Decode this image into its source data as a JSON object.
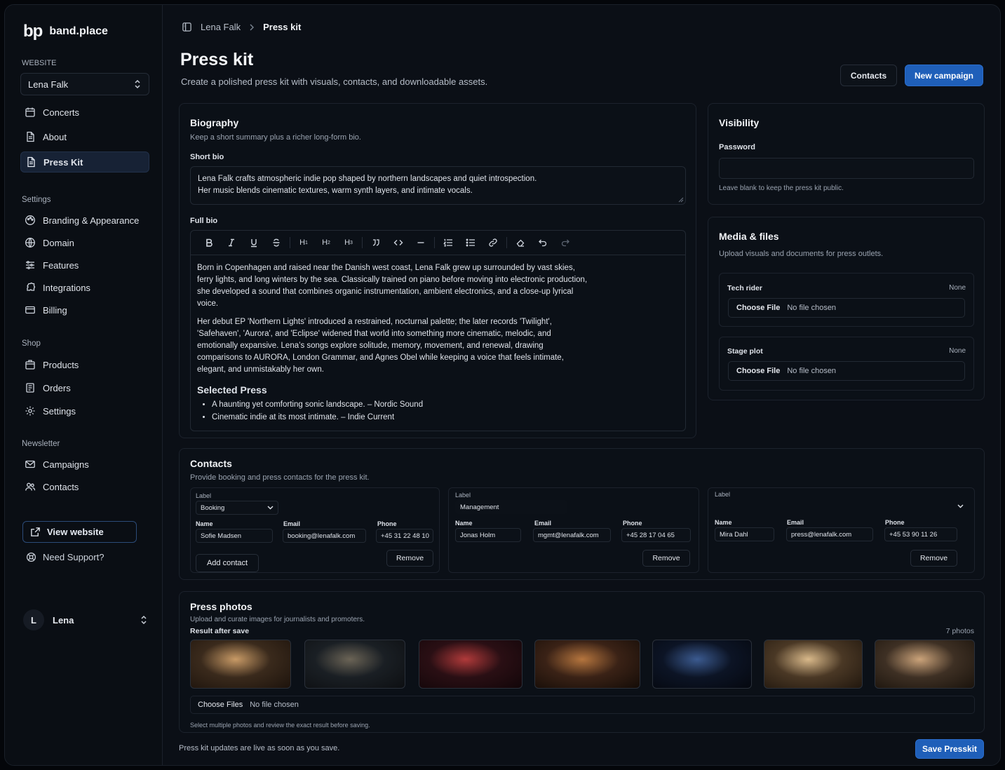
{
  "app": {
    "logo_mark": "bp",
    "name": "band.place"
  },
  "sidebar": {
    "website_label": "WEBSITE",
    "site_select": "Lena Falk",
    "website_items": [
      {
        "label": "Concerts",
        "icon": "calendar-icon"
      },
      {
        "label": "About",
        "icon": "document-icon"
      },
      {
        "label": "Press Kit",
        "icon": "document-icon",
        "active": true
      }
    ],
    "settings_label": "Settings",
    "settings_items": [
      {
        "label": "Branding & Appearance",
        "icon": "palette-icon"
      },
      {
        "label": "Domain",
        "icon": "globe-icon"
      },
      {
        "label": "Features",
        "icon": "sliders-icon"
      },
      {
        "label": "Integrations",
        "icon": "puzzle-icon"
      },
      {
        "label": "Billing",
        "icon": "credit-card-icon"
      }
    ],
    "shop_label": "Shop",
    "shop_items": [
      {
        "label": "Products",
        "icon": "box-icon"
      },
      {
        "label": "Orders",
        "icon": "receipt-icon"
      },
      {
        "label": "Settings",
        "icon": "gear-icon"
      }
    ],
    "newsletter_label": "Newsletter",
    "newsletter_items": [
      {
        "label": "Campaigns",
        "icon": "mail-icon"
      },
      {
        "label": "Contacts",
        "icon": "users-icon"
      }
    ],
    "view_website": "View website",
    "support": "Need Support?",
    "user": {
      "initial": "L",
      "name": "Lena"
    }
  },
  "breadcrumb": {
    "parent": "Lena Falk",
    "current": "Press kit"
  },
  "page": {
    "title": "Press kit",
    "subtitle": "Create a polished press kit with visuals, contacts, and downloadable assets.",
    "contacts_button": "Contacts",
    "new_campaign_button": "New campaign"
  },
  "biography": {
    "title": "Biography",
    "subtitle": "Keep a short summary plus a richer long-form bio.",
    "short_bio_label": "Short bio",
    "short_bio_line1": "Lena Falk crafts atmospheric indie pop shaped by northern landscapes and quiet introspection.",
    "short_bio_line2": "Her music blends cinematic textures, warm synth layers, and intimate vocals.",
    "full_bio_label": "Full bio",
    "toolbar": [
      "B",
      "I",
      "U",
      "S",
      "H1",
      "H2",
      "H3",
      "quote",
      "code",
      "hr",
      "ordered-list",
      "bullet-list",
      "link",
      "eraser",
      "undo",
      "redo"
    ],
    "paragraph1": "Born in Copenhagen and raised near the Danish west coast, Lena Falk grew up surrounded by vast skies, ferry lights, and long winters by the sea. Classically trained on piano before moving into electronic production, she developed a sound that combines organic instrumentation, ambient electronics, and a close-up lyrical voice.",
    "paragraph2": "Her debut EP 'Northern Lights' introduced a restrained, nocturnal palette; the later records 'Twilight', 'Safehaven', 'Aurora', and 'Eclipse' widened that world into something more cinematic, melodic, and emotionally expansive. Lena’s songs explore solitude, memory, movement, and renewal, drawing comparisons to AURORA, London Grammar, and Agnes Obel while keeping a voice that feels intimate, elegant, and unmistakably her own.",
    "selected_press_heading": "Selected Press",
    "press_quotes": [
      "A haunting yet comforting sonic landscape. – Nordic Sound",
      "Cinematic indie at its most intimate. – Indie Current"
    ]
  },
  "visibility": {
    "title": "Visibility",
    "password_label": "Password",
    "password_value": "",
    "hint": "Leave blank to keep the press kit public."
  },
  "media": {
    "title": "Media & files",
    "subtitle": "Upload visuals and documents for press outlets.",
    "files": [
      {
        "label": "Tech rider",
        "status": "None",
        "button": "Choose File",
        "file": "No file chosen"
      },
      {
        "label": "Stage plot",
        "status": "None",
        "button": "Choose File",
        "file": "No file chosen"
      }
    ]
  },
  "contacts": {
    "title": "Contacts",
    "subtitle": "Provide booking and press contacts for the press kit.",
    "label_caption": "Label",
    "name_caption": "Name",
    "email_caption": "Email",
    "phone_caption": "Phone",
    "remove_button": "Remove",
    "add_button": "Add contact",
    "items": [
      {
        "label": "Booking",
        "name": "Sofie Madsen",
        "email": "booking@lenafalk.com",
        "phone": "+45 31 22 48 10"
      },
      {
        "label": "Management",
        "name": "Jonas Holm",
        "email": "mgmt@lenafalk.com",
        "phone": "+45 28 17 04 65"
      },
      {
        "label": "",
        "name": "Mira Dahl",
        "email": "press@lenafalk.com",
        "phone": "+45 53 90 11 26"
      }
    ]
  },
  "photos": {
    "title": "Press photos",
    "subtitle": "Upload and curate images for journalists and promoters.",
    "result_label": "Result after save",
    "count": "7 photos",
    "button": "Choose Files",
    "file": "No file chosen",
    "hint": "Select multiple photos and review the exact result before saving.",
    "colors": [
      [
        "#3a2a1c",
        "#c89a66",
        "#1d130c"
      ],
      [
        "#1a1f24",
        "#6b6456",
        "#0d0f12"
      ],
      [
        "#2a0f14",
        "#b03a3a",
        "#120609"
      ],
      [
        "#3a2216",
        "#b5753e",
        "#140c07"
      ],
      [
        "#0c1425",
        "#3b5a8f",
        "#05080f"
      ],
      [
        "#4a3825",
        "#d9b98a",
        "#21170e"
      ],
      [
        "#3e3024",
        "#cba37a",
        "#1a130c"
      ]
    ]
  },
  "footer": {
    "note": "Press kit updates are live as soon as you save.",
    "save_button": "Save Presskit"
  },
  "colors": {
    "accent": "#1f5fb9",
    "background": "#0b0f16",
    "border": "#1c222c"
  }
}
